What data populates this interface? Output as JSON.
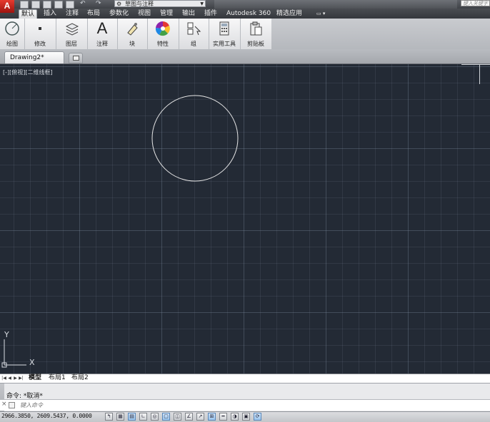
{
  "app": {
    "logo_letter": "A"
  },
  "quick_access": {
    "icons": [
      "new-icon",
      "open-icon",
      "save-icon",
      "saveas-icon",
      "print-icon",
      "undo-icon",
      "redo-icon"
    ],
    "workspace_label": "草图与注释"
  },
  "search": {
    "placeholder": "键入关键字"
  },
  "ribbon_tabs": [
    {
      "label": "默认",
      "active": true
    },
    {
      "label": "插入"
    },
    {
      "label": "注释"
    },
    {
      "label": "布局"
    },
    {
      "label": "参数化"
    },
    {
      "label": "视图"
    },
    {
      "label": "管理"
    },
    {
      "label": "输出"
    },
    {
      "label": "插件"
    },
    {
      "label": "Autodesk 360"
    },
    {
      "label": "精选应用"
    }
  ],
  "ribbon_panels": [
    {
      "label": "绘图",
      "icon": "draw-icon"
    },
    {
      "label": "修改",
      "icon": "modify-icon"
    },
    {
      "label": "图层",
      "icon": "layers-icon"
    },
    {
      "label": "注释",
      "icon": "annotation-icon",
      "glyph": "A"
    },
    {
      "label": "块",
      "icon": "block-icon"
    },
    {
      "label": "特性",
      "icon": "properties-icon"
    },
    {
      "label": "组",
      "icon": "group-icon"
    },
    {
      "label": "实用工具",
      "icon": "utilities-icon"
    },
    {
      "label": "剪贴板",
      "icon": "clipboard-icon"
    }
  ],
  "document": {
    "tab_label": "Drawing2*"
  },
  "viewport": {
    "label": "[-][俯视][二维线框]",
    "background": "#232a35",
    "circle_color": "#e6e6e6"
  },
  "ucs": {
    "x_label": "X",
    "y_label": "Y"
  },
  "layout_tabs": [
    {
      "label": "模型",
      "active": true
    },
    {
      "label": "布局1"
    },
    {
      "label": "布局2"
    }
  ],
  "command": {
    "history": "命令: *取消*",
    "input_placeholder": "键入命令"
  },
  "status": {
    "coordinates": "2966.3850, 2609.5437, 0.0000",
    "toggles": [
      "infer-constraints",
      "snap-mode",
      "grid-display",
      "ortho-mode",
      "polar-tracking",
      "object-snap",
      "3d-object-snap",
      "object-snap-tracking",
      "dynamic-ucs",
      "dynamic-input",
      "show-lineweight",
      "transparency",
      "quick-properties",
      "selection-cycling"
    ]
  }
}
